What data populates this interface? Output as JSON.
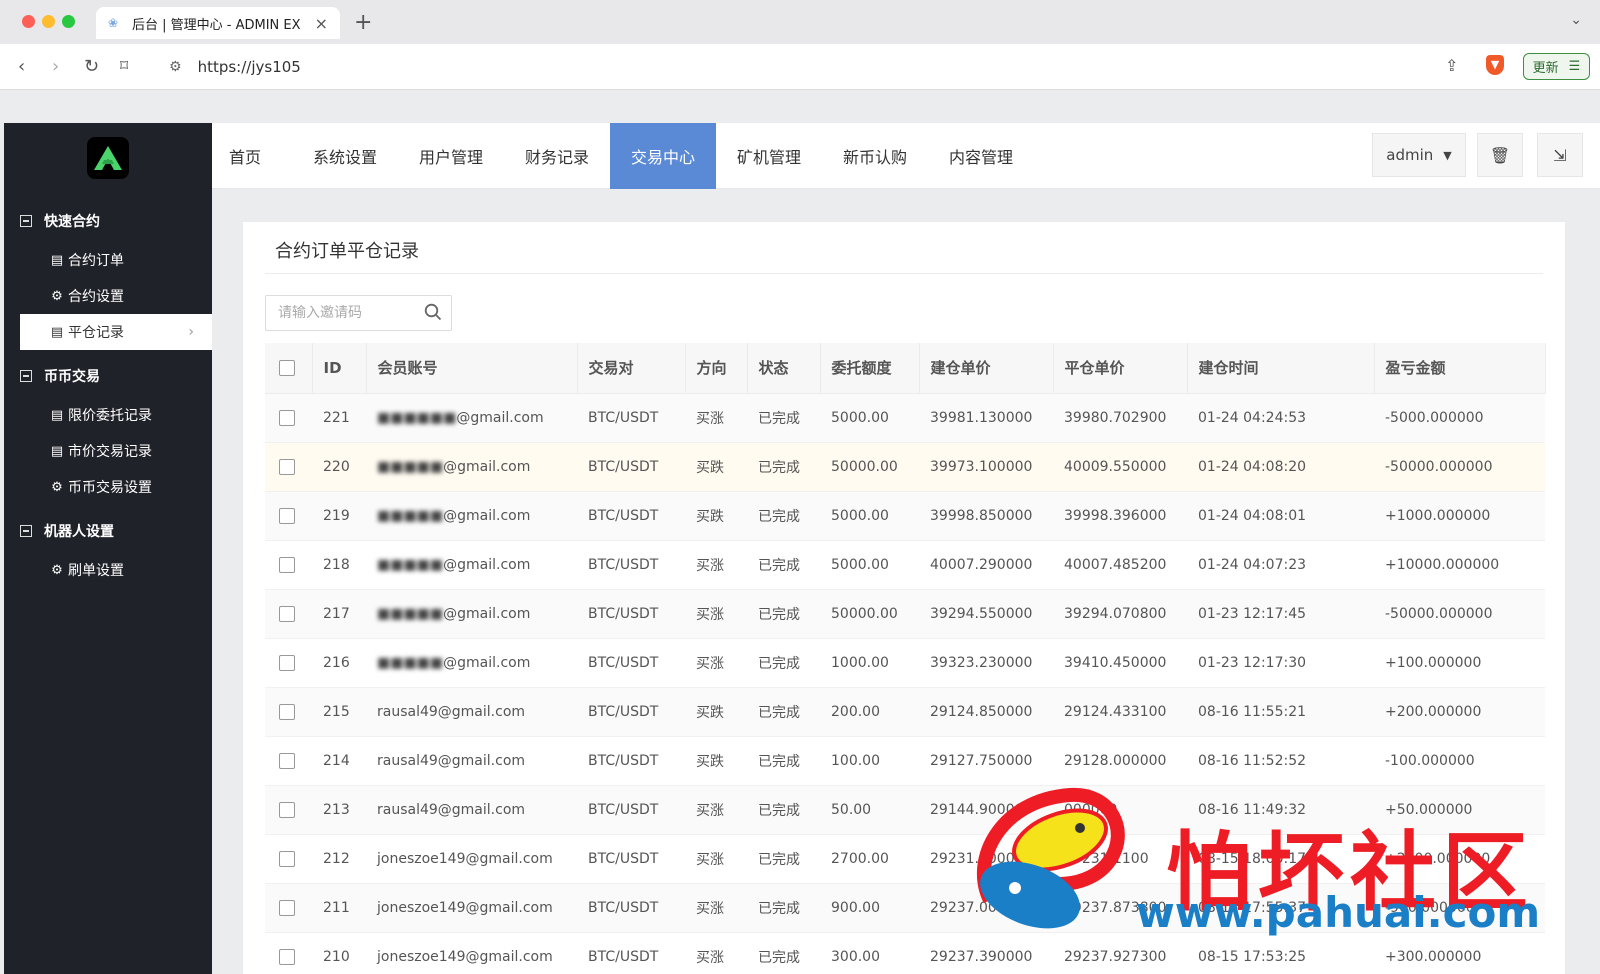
{
  "browser": {
    "tab_title": "后台 | 管理中心 - ADMIN EX",
    "url": "https://jys105",
    "update_label": "更新"
  },
  "sidebar": {
    "groups": [
      {
        "label": "快速合约",
        "items": [
          {
            "label": "合约订单",
            "icon": "list-icon"
          },
          {
            "label": "合约设置",
            "icon": "gear-icon"
          },
          {
            "label": "平仓记录",
            "icon": "list-icon",
            "active": true
          }
        ]
      },
      {
        "label": "币币交易",
        "items": [
          {
            "label": "限价委托记录",
            "icon": "list-icon"
          },
          {
            "label": "市价交易记录",
            "icon": "list-icon"
          },
          {
            "label": "币币交易设置",
            "icon": "gear-icon"
          }
        ]
      },
      {
        "label": "机器人设置",
        "items": [
          {
            "label": "刷单设置",
            "icon": "gear-icon"
          }
        ]
      }
    ]
  },
  "topnav": {
    "items": [
      "首页",
      "系统设置",
      "用户管理",
      "财务记录",
      "交易中心",
      "矿机管理",
      "新币认购",
      "内容管理"
    ],
    "active": "交易中心",
    "user": "admin"
  },
  "page": {
    "title": "合约订单平仓记录",
    "search_placeholder": "请输入邀请码"
  },
  "table": {
    "columns": [
      "ID",
      "会员账号",
      "交易对",
      "方向",
      "状态",
      "委托额度",
      "建仓单价",
      "平仓单价",
      "建仓时间",
      "盈亏金额"
    ],
    "rows": [
      {
        "id": "221",
        "account_hidden": "■■■■■■",
        "account": "@gmail.com",
        "pair": "BTC/USDT",
        "dir": "买涨",
        "status": "已完成",
        "amount": "5000.00",
        "open": "39981.130000",
        "close": "39980.702900",
        "close_color": "red",
        "time": "01-24 04:24:53",
        "pl": "-5000.000000",
        "pl_color": "red"
      },
      {
        "id": "220",
        "account_hidden": "■■■■■",
        "account": "@gmail.com",
        "pair": "BTC/USDT",
        "dir": "买跌",
        "status": "已完成",
        "amount": "50000.00",
        "open": "39973.100000",
        "close": "40009.550000",
        "close_color": "red",
        "time": "01-24 04:08:20",
        "pl": "-50000.000000",
        "pl_color": "red"
      },
      {
        "id": "219",
        "account_hidden": "■■■■■",
        "account": "@gmail.com",
        "pair": "BTC/USDT",
        "dir": "买跌",
        "status": "已完成",
        "amount": "5000.00",
        "open": "39998.850000",
        "close": "39998.396000",
        "close_color": "green",
        "time": "01-24 04:08:01",
        "pl": "+1000.000000",
        "pl_color": "green"
      },
      {
        "id": "218",
        "account_hidden": "■■■■■",
        "account": "@gmail.com",
        "pair": "BTC/USDT",
        "dir": "买涨",
        "status": "已完成",
        "amount": "5000.00",
        "open": "40007.290000",
        "close": "40007.485200",
        "close_color": "green",
        "time": "01-24 04:07:23",
        "pl": "+10000.000000",
        "pl_color": "green"
      },
      {
        "id": "217",
        "account_hidden": "■■■■■",
        "account": "@gmail.com",
        "pair": "BTC/USDT",
        "dir": "买涨",
        "status": "已完成",
        "amount": "50000.00",
        "open": "39294.550000",
        "close": "39294.070800",
        "close_color": "red",
        "time": "01-23 12:17:45",
        "pl": "-50000.000000",
        "pl_color": "red"
      },
      {
        "id": "216",
        "account_hidden": "■■■■■",
        "account": "@gmail.com",
        "pair": "BTC/USDT",
        "dir": "买涨",
        "status": "已完成",
        "amount": "1000.00",
        "open": "39323.230000",
        "close": "39410.450000",
        "close_color": "green",
        "time": "01-23 12:17:30",
        "pl": "+100.000000",
        "pl_color": "green"
      },
      {
        "id": "215",
        "account_hidden": "",
        "account": "rausal49@gmail.com",
        "pair": "BTC/USDT",
        "dir": "买跌",
        "status": "已完成",
        "amount": "200.00",
        "open": "29124.850000",
        "close": "29124.433100",
        "close_color": "green",
        "time": "08-16 11:55:21",
        "pl": "+200.000000",
        "pl_color": "green"
      },
      {
        "id": "214",
        "account_hidden": "",
        "account": "rausal49@gmail.com",
        "pair": "BTC/USDT",
        "dir": "买跌",
        "status": "已完成",
        "amount": "100.00",
        "open": "29127.750000",
        "close": "29128.000000",
        "close_color": "red",
        "time": "08-16 11:52:52",
        "pl": "-100.000000",
        "pl_color": "red"
      },
      {
        "id": "213",
        "account_hidden": "",
        "account": "rausal49@gmail.com",
        "pair": "BTC/USDT",
        "dir": "买涨",
        "status": "已完成",
        "amount": "50.00",
        "open": "29144.900000",
        "close": "000000",
        "close_color": "green",
        "time": "08-16 11:49:32",
        "pl": "+50.000000",
        "pl_color": "green"
      },
      {
        "id": "212",
        "account_hidden": "",
        "account": "joneszoe149@gmail.com",
        "pair": "BTC/USDT",
        "dir": "买涨",
        "status": "已完成",
        "amount": "2700.00",
        "open": "29231.000000",
        "close": "29231.1100",
        "close_color": "green",
        "time": "08-15 18:00:17",
        "pl": "+2700.000000",
        "pl_color": "green"
      },
      {
        "id": "211",
        "account_hidden": "",
        "account": "joneszoe149@gmail.com",
        "pair": "BTC/USDT",
        "dir": "买涨",
        "status": "已完成",
        "amount": "900.00",
        "open": "29237.000000",
        "close": "29237.873800",
        "close_color": "red",
        "time": "08-15 17:55:37",
        "pl": "-900.000000",
        "pl_color": "red"
      },
      {
        "id": "210",
        "account_hidden": "",
        "account": "joneszoe149@gmail.com",
        "pair": "BTC/USDT",
        "dir": "买涨",
        "status": "已完成",
        "amount": "300.00",
        "open": "29237.390000",
        "close": "29237.927300",
        "close_color": "green",
        "time": "08-15 17:53:25",
        "pl": "+300.000000",
        "pl_color": "green"
      }
    ]
  },
  "watermark": {
    "text": "怕坏社区",
    "url": "www.pahuai.com"
  }
}
